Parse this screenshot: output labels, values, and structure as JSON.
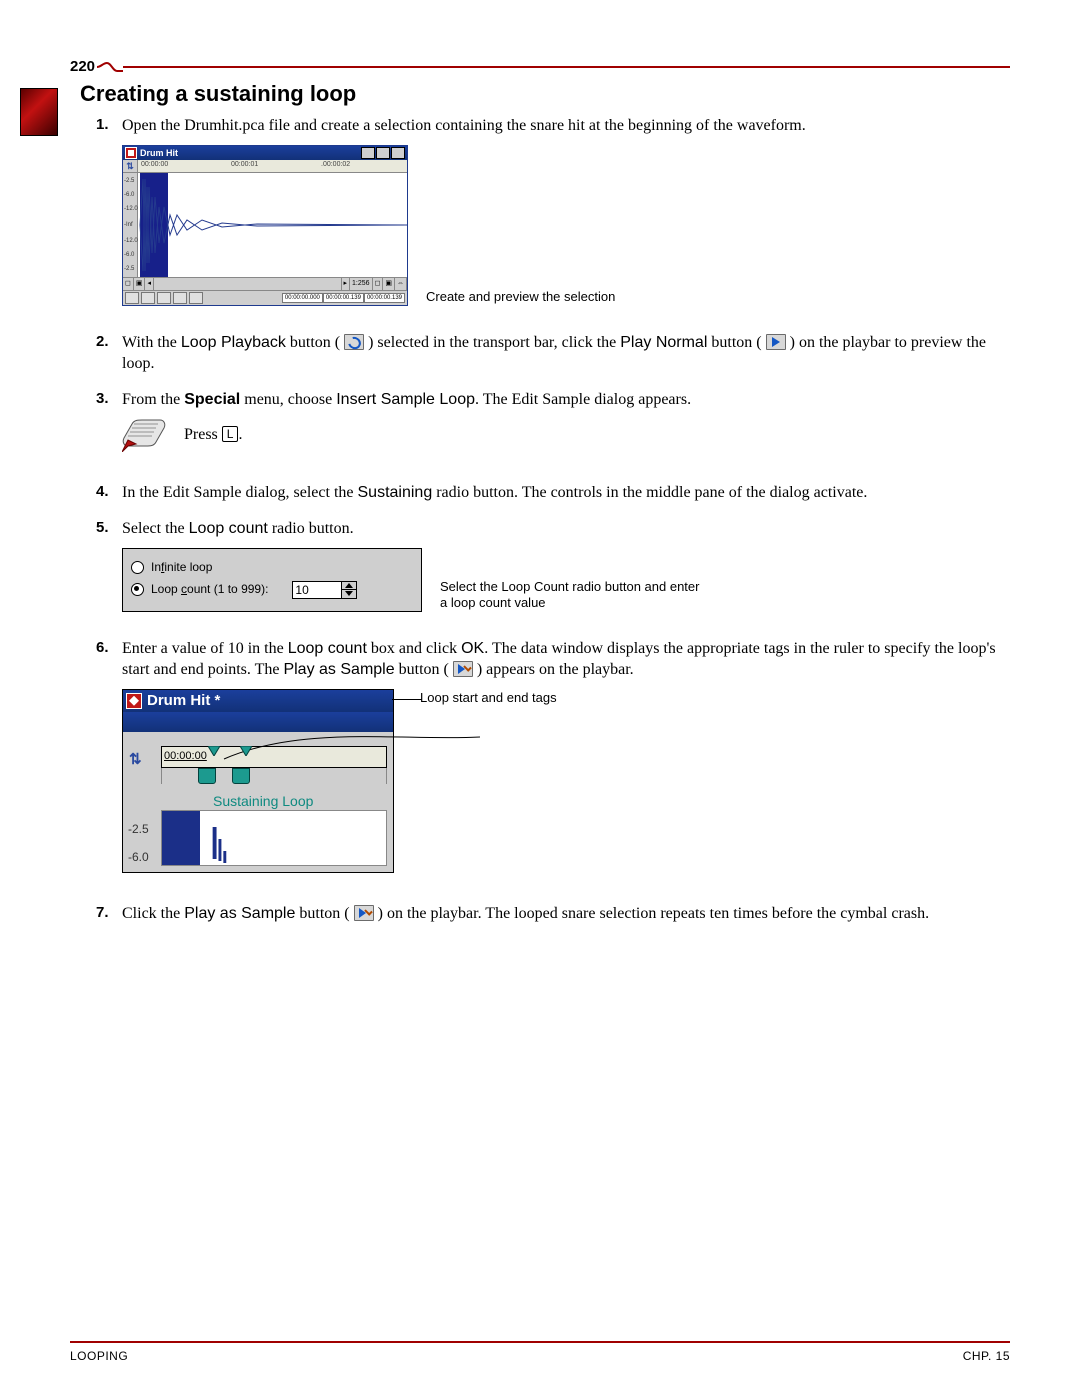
{
  "page_number": "220",
  "section_title": "Creating a sustaining loop",
  "steps": {
    "s1": {
      "num": "1.",
      "text": "Open the Drumhit.pca file and create a selection containing the snare hit at the beginning of the waveform."
    },
    "s2": {
      "num": "2.",
      "t1": "With the",
      "btn1": "Loop Playback",
      "t2": "button (",
      "t3": ") selected in the transport bar, click the",
      "btn2": "Play Normal",
      "t4": "button (",
      "t5": ") on the playbar to preview the loop."
    },
    "s3": {
      "num": "3.",
      "t1": "From the",
      "menu": "Special",
      "t2": "menu, choose",
      "cmd": "Insert Sample Loop",
      "t3": ". The Edit Sample dialog appears."
    },
    "kb": {
      "press": "Press",
      "key": "L",
      "after": "."
    },
    "s4": {
      "num": "4.",
      "t1": "In the Edit Sample dialog, select the",
      "opt": "Sustaining",
      "t2": "radio button. The controls in the middle pane of the dialog activate."
    },
    "s5": {
      "num": "5.",
      "t1": "Select the",
      "opt": "Loop count",
      "t2": "radio button."
    },
    "s6": {
      "num": "6.",
      "t1": "Enter a value of 10 in the",
      "opt1": "Loop count",
      "t2": "box and click",
      "ok": "OK",
      "t3": ". The data window displays the appropriate tags in the ruler to specify the loop's start and end points. The",
      "btn": "Play as Sample",
      "t4": "button (",
      "t5": ") appears on the playbar."
    },
    "s7": {
      "num": "7.",
      "t1": "Click the",
      "btn": "Play as Sample",
      "t2": "button (",
      "t3": ") on the playbar. The looped snare selection repeats ten times before the cymbal crash."
    }
  },
  "fig1": {
    "title": "Drum Hit",
    "ruler": {
      "t0": "00:00:00",
      "t1": "00:00:01",
      "t2": ".00:00:02"
    },
    "yticks": [
      "-2.5",
      "-6.0",
      "-12.0",
      "-Inf",
      "-12.0",
      "-6.0",
      "-2.5"
    ],
    "zoom": "1:256",
    "times": [
      "00:00:00.000",
      "00:00:00.139",
      "00:00:00.139"
    ],
    "caption": "Create and preview the selection"
  },
  "fig2": {
    "infinite_html": "In<u>f</u>inite loop",
    "loopcount_html": "Loop <u>c</u>ount (1 to 999):",
    "value": "10",
    "caption": "Select the Loop Count radio button and enter a loop count value"
  },
  "fig3": {
    "title": "Drum Hit *",
    "time": "00:00:00",
    "sustaining": "Sustaining Loop",
    "y1": "-2.5",
    "y2": "-6.0",
    "caption": "Loop start and end tags"
  },
  "footer": {
    "left": "LOOPING",
    "right": "CHP. 15"
  }
}
